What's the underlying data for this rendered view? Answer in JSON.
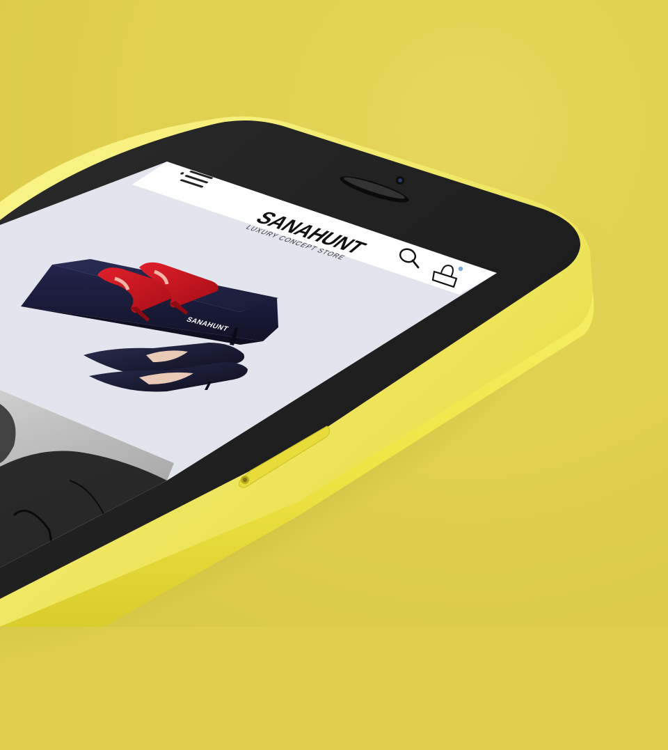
{
  "app": {
    "brand_name": "SANAHUNT",
    "brand_tagline": "LUXURY CONCEPT STORE",
    "box_brand_text": "SANAHUNT"
  },
  "icons": {
    "menu": "hamburger-menu-icon",
    "search": "search-icon",
    "bag": "shopping-bag-icon"
  },
  "colors": {
    "background": "#dfcf4d",
    "phone_body": "#f1e94a",
    "phone_bezel": "#1e1e1e",
    "screen_bg": "#e2e4ee",
    "header_bg": "#ffffff",
    "shoe_red": "#c8141e",
    "box_navy": "#1f2240"
  }
}
